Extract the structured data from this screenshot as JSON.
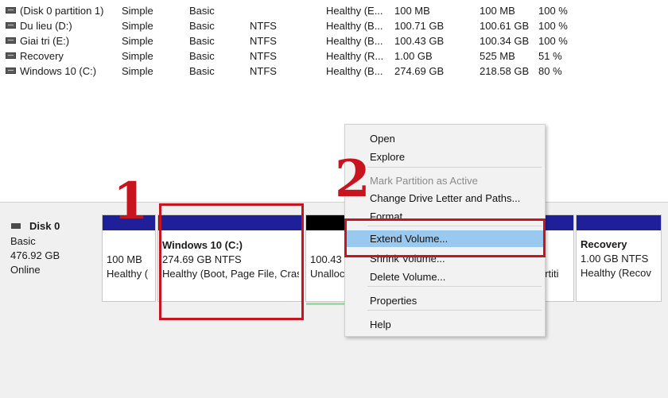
{
  "volumes": [
    {
      "name": "(Disk 0 partition 1)",
      "layout": "Simple",
      "type": "Basic",
      "fs": "",
      "status": "Healthy (E...",
      "capacity": "100 MB",
      "free": "100 MB",
      "pct": "100 %"
    },
    {
      "name": "Du lieu (D:)",
      "layout": "Simple",
      "type": "Basic",
      "fs": "NTFS",
      "status": "Healthy (B...",
      "capacity": "100.71 GB",
      "free": "100.61 GB",
      "pct": "100 %"
    },
    {
      "name": "Giai tri (E:)",
      "layout": "Simple",
      "type": "Basic",
      "fs": "NTFS",
      "status": "Healthy (B...",
      "capacity": "100.43 GB",
      "free": "100.34 GB",
      "pct": "100 %"
    },
    {
      "name": "Recovery",
      "layout": "Simple",
      "type": "Basic",
      "fs": "NTFS",
      "status": "Healthy (R...",
      "capacity": "1.00 GB",
      "free": "525 MB",
      "pct": "51 %"
    },
    {
      "name": "Windows 10 (C:)",
      "layout": "Simple",
      "type": "Basic",
      "fs": "NTFS",
      "status": "Healthy (B...",
      "capacity": "274.69 GB",
      "free": "218.58 GB",
      "pct": "80 %"
    }
  ],
  "disk": {
    "title": "Disk 0",
    "type": "Basic",
    "size": "476.92 GB",
    "state": "Online"
  },
  "partitions": {
    "p1": {
      "size": "100 MB",
      "status": "Healthy ("
    },
    "c": {
      "title": "Windows 10  (C:)",
      "size": "274.69 GB NTFS",
      "status": "Healthy (Boot, Page File, Cras"
    },
    "unalloc": {
      "size": "100.43",
      "status": "Unalloc"
    },
    "hidden": {
      "status": "artiti"
    },
    "recovery": {
      "title": "Recovery",
      "size": "1.00 GB NTFS",
      "status": "Healthy (Recov"
    }
  },
  "menu": {
    "open": "Open",
    "explore": "Explore",
    "mark_active": "Mark Partition as Active",
    "change_letter": "Change Drive Letter and Paths...",
    "format": "Format...",
    "extend": "Extend Volume...",
    "shrink": "Shrink Volume...",
    "delete": "Delete Volume...",
    "properties": "Properties",
    "help": "Help"
  },
  "annotations": {
    "step1": "1",
    "step2": "2",
    "color": "#c8141e"
  },
  "colors": {
    "partition_bar": "#1f1f9a",
    "unallocated_bar": "#000000",
    "menu_highlight": "#99c9ef"
  }
}
